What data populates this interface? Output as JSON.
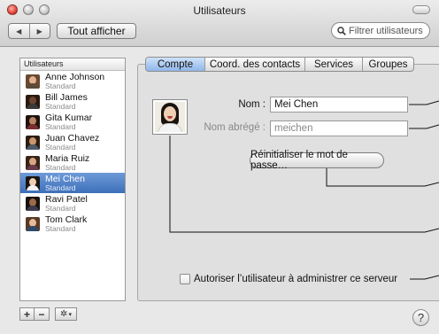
{
  "window": {
    "title": "Utilisateurs"
  },
  "toolbar": {
    "back_glyph": "◀",
    "forward_glyph": "▶",
    "show_all": "Tout afficher",
    "search_placeholder": "Filtrer utilisateurs"
  },
  "sidebar": {
    "header": "Utilisateurs",
    "users": [
      {
        "name": "Anne Johnson",
        "role": "Standard",
        "skin": "#e2b392",
        "hair": "#6a4a30",
        "shirt": "#5b4a3a"
      },
      {
        "name": "Bill James",
        "role": "Standard",
        "skin": "#6b4630",
        "hair": "#2a1a10",
        "shirt": "#3a3a3a"
      },
      {
        "name": "Gita Kumar",
        "role": "Standard",
        "skin": "#b98464",
        "hair": "#1e140e",
        "shirt": "#7a2e2e"
      },
      {
        "name": "Juan Chavez",
        "role": "Standard",
        "skin": "#c9966e",
        "hair": "#2c1d12",
        "shirt": "#4c5a6a"
      },
      {
        "name": "Maria Ruiz",
        "role": "Standard",
        "skin": "#d8a684",
        "hair": "#3a2418",
        "shirt": "#6a3a4a"
      },
      {
        "name": "Mei Chen",
        "role": "Standard",
        "skin": "#efcfb2",
        "hair": "#1a1410",
        "shirt": "#f4f4f4",
        "selected": true
      },
      {
        "name": "Ravi Patel",
        "role": "Standard",
        "skin": "#9c6a4a",
        "hair": "#1a120c",
        "shirt": "#3c3c50"
      },
      {
        "name": "Tom Clark",
        "role": "Standard",
        "skin": "#e6bc9a",
        "hair": "#5a3a22",
        "shirt": "#2e4a6a"
      }
    ],
    "add_label": "+",
    "remove_label": "−",
    "gear_glyph": "✲",
    "gear_arrow": "▾"
  },
  "tabs": [
    "Compte",
    "Coord. des contacts",
    "Services",
    "Groupes"
  ],
  "form": {
    "name_label": "Nom :",
    "name_value": "Mei Chen",
    "short_label": "Nom abrégé :",
    "short_value": "meichen",
    "reset_button": "Réinitialiser le mot de passe…",
    "admin_checkbox": "Autoriser l’utilisateur à administrer ce serveur",
    "admin_checked": false
  },
  "help_label": "?",
  "colors": {
    "selection": "#3d6fb9",
    "active_tab": "#8fb6ea",
    "close_button": "#e04438"
  }
}
